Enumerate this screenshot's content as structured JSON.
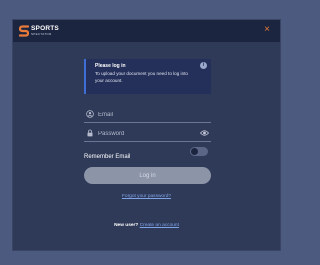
{
  "brand": {
    "name_top": "SPORTS",
    "name_bottom": "SPECTATOR",
    "accent_color": "#e87a3a"
  },
  "header": {
    "close_symbol": "×"
  },
  "info": {
    "title": "Please log in",
    "message": "To upload your document you need to log into your account.",
    "icon": "info-icon"
  },
  "form": {
    "email_placeholder": "Email",
    "password_placeholder": "Password",
    "remember_label": "Remember Email",
    "remember_checked": false,
    "login_label": "Log in",
    "forgot_label": "Forgot your password?"
  },
  "signup": {
    "question": "New user?",
    "link_label": "Create an account"
  }
}
